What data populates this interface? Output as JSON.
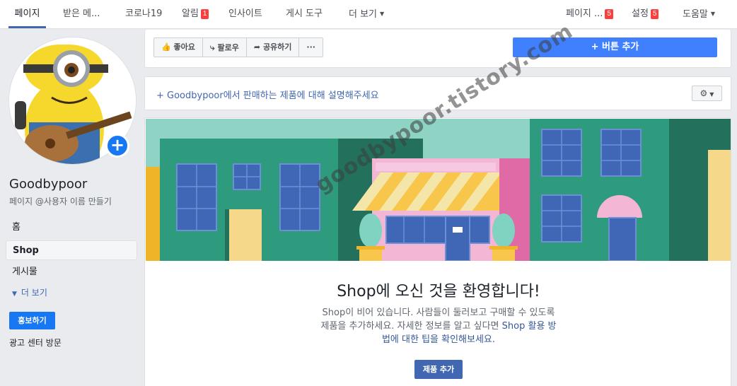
{
  "topnav": {
    "tabs": [
      {
        "label": "페이지",
        "active": true
      },
      {
        "label": "받은 메..."
      },
      {
        "label": "코로나19"
      },
      {
        "label": "알림",
        "badge": "1"
      },
      {
        "label": "인사이트"
      },
      {
        "label": "게시 도구"
      },
      {
        "label": "더 보기"
      }
    ],
    "right": [
      {
        "label": "페이지 ...",
        "badge": "5"
      },
      {
        "label": "설정",
        "badge": "5"
      },
      {
        "label": "도움말"
      }
    ]
  },
  "sidebar": {
    "page_name": "Goodbypoor",
    "handle": "페이지 @사용자 이름 만들기",
    "items": [
      "홈",
      "Shop",
      "게시물"
    ],
    "more": "더 보기",
    "promote": "홍보하기",
    "ad_center": "광고 센터 방문"
  },
  "actions": {
    "like": "좋아요",
    "follow": "팔로우",
    "share": "공유하기",
    "more": "···",
    "add_button": "+ 버튼 추가"
  },
  "describe": {
    "link": "+ Goodbypoor에서 판매하는 제품에 대해 설명해주세요"
  },
  "shop": {
    "title": "Shop에 오신 것을 환영합니다!",
    "desc_part1": "Shop이 비어 있습니다. 사람들이 둘러보고 구매할 수 있도록 제품을 추가하세요. 자세한 정보를 알고 싶다면 ",
    "desc_link": "Shop 활용 방법에 대한 팁을 확인해보세요.",
    "add_product": "제품 추가"
  },
  "watermark": "goodbypoor.tistory.com",
  "colors": {
    "fb_blue": "#4267b2",
    "button_blue": "#4080ff",
    "badge_red": "#fa3e3e"
  }
}
